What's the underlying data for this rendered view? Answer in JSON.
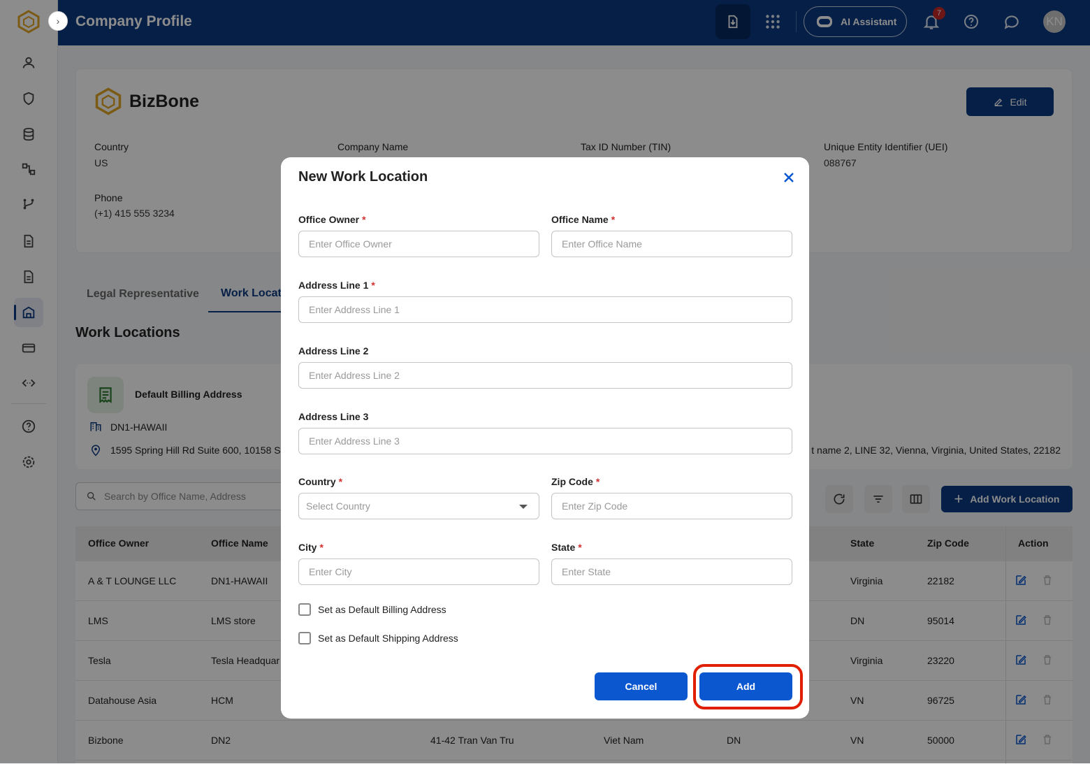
{
  "header": {
    "title": "Company Profile",
    "ai_label": "AI Assistant",
    "notif_count": "7",
    "avatar": "KN"
  },
  "company": {
    "name": "BizBone",
    "edit_label": "Edit",
    "fields": {
      "country_label": "Country",
      "country_value": "US",
      "company_name_label": "Company Name",
      "tin_label": "Tax ID Number (TIN)",
      "uei_label": "Unique Entity Identifier (UEI)",
      "uei_value": "088767",
      "phone_label": "Phone",
      "phone_value": "(+1) 415 555 3234"
    }
  },
  "tabs": [
    {
      "label": "Legal Representative"
    },
    {
      "label": "Work Locat"
    }
  ],
  "section_title": "Work Locations",
  "default_address": {
    "title": "Default Billing Address",
    "office": "DN1-HAWAII",
    "address": "1595 Spring Hill Rd Suite 600, 10158 S",
    "address_right": "t name 2, LINE 32, Vienna, Virginia, United States, 22182"
  },
  "toolbar": {
    "search_placeholder": "Search by Office Name, Address",
    "add_label": "Add Work Location"
  },
  "table": {
    "headers": {
      "owner": "Office Owner",
      "name": "Office Name",
      "state": "State",
      "zip": "Zip Code",
      "action": "Action"
    },
    "rows": [
      {
        "owner": "A & T LOUNGE LLC",
        "name": "DN1-HAWAII",
        "address": "",
        "country": "",
        "city": "",
        "state": "Virginia",
        "zip": "22182"
      },
      {
        "owner": "LMS",
        "name": "LMS store",
        "address": "",
        "country": "",
        "city": "",
        "state": "DN",
        "zip": "95014"
      },
      {
        "owner": "Tesla",
        "name": "Tesla Headquar",
        "address": "",
        "country": "",
        "city": "",
        "state": "Virginia",
        "zip": "23220"
      },
      {
        "owner": "Datahouse Asia",
        "name": "HCM",
        "address": "",
        "country": "",
        "city": "",
        "state": "VN",
        "zip": "96725"
      },
      {
        "owner": "Bizbone",
        "name": "DN2",
        "address": "41-42 Tran Van Tru",
        "country": "Viet Nam",
        "city": "DN",
        "state": "VN",
        "zip": "50000"
      }
    ]
  },
  "modal": {
    "title": "New Work Location",
    "office_owner": {
      "label": "Office Owner",
      "placeholder": "Enter Office Owner"
    },
    "office_name": {
      "label": "Office Name",
      "placeholder": "Enter Office Name"
    },
    "address1": {
      "label": "Address Line 1",
      "placeholder": "Enter Address Line 1"
    },
    "address2": {
      "label": "Address Line 2",
      "placeholder": "Enter Address Line 2"
    },
    "address3": {
      "label": "Address Line 3",
      "placeholder": "Enter Address Line 3"
    },
    "country": {
      "label": "Country",
      "placeholder": "Select Country"
    },
    "zip": {
      "label": "Zip Code",
      "placeholder": "Enter Zip Code"
    },
    "city": {
      "label": "City",
      "placeholder": "Enter City"
    },
    "state": {
      "label": "State",
      "placeholder": "Enter State"
    },
    "default_billing": "Set as Default Billing Address",
    "default_shipping": "Set as Default Shipping Address",
    "cancel_label": "Cancel",
    "add_label": "Add",
    "required_mark": "*"
  },
  "colors": {
    "primary": "#0b3a82",
    "button": "#0b57d0",
    "required": "#d32f2f",
    "highlight": "#e01e00"
  }
}
